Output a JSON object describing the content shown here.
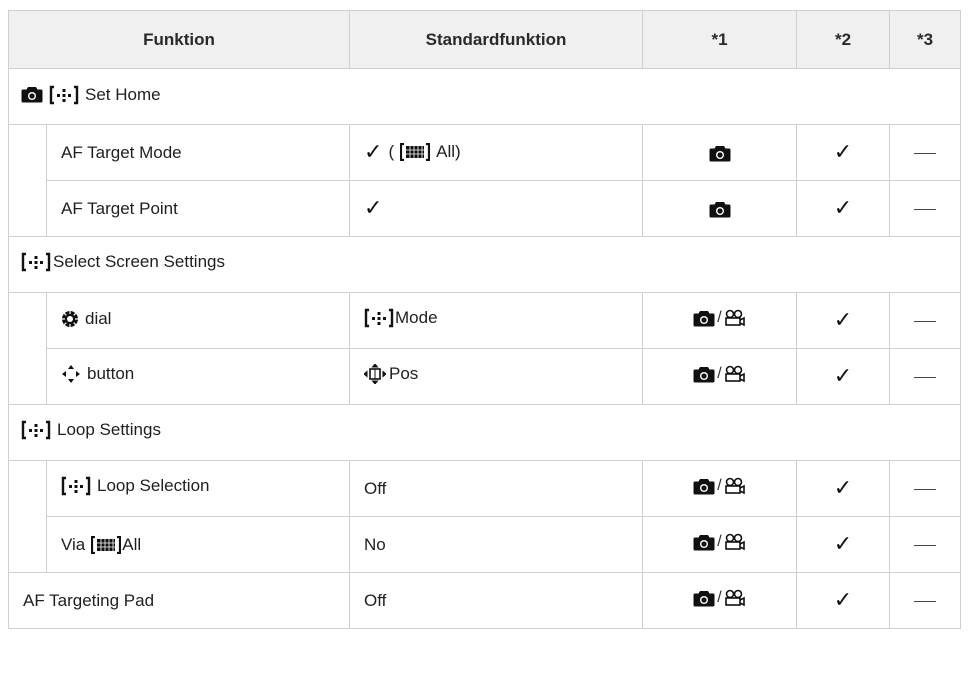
{
  "table": {
    "headers": [
      "Funktion",
      "Standardfunktion",
      "*1",
      "*2",
      "*3"
    ],
    "sections": [
      {
        "title": "Set Home",
        "title_icons": [
          "camera-icon",
          "af-area-icon"
        ],
        "rows": [
          {
            "name": "AF Target Mode",
            "std_prefix_icon": "check-icon",
            "std_paren_open": "(",
            "std_icon": "all-target-icon",
            "std_text": "All)",
            "col1": "camera-icon",
            "col2": "check-icon",
            "col3": "dash"
          },
          {
            "name": "AF Target Point",
            "std_prefix_icon": "check-icon",
            "col1": "camera-icon",
            "col2": "check-icon",
            "col3": "dash"
          }
        ]
      },
      {
        "title": "Select Screen Settings",
        "title_icons": [
          "af-area-icon"
        ],
        "rows": [
          {
            "name_icon": "dial-icon",
            "name": "dial",
            "std_icon": "af-area-icon",
            "std_text": "Mode",
            "col1": "camera-video-icon",
            "col2": "check-icon",
            "col3": "dash"
          },
          {
            "name_icon": "arrow-pad-icon",
            "name": "button",
            "std_icon": "arrow-pad-small-icon",
            "std_text": "Pos",
            "col1": "camera-video-icon",
            "col2": "check-icon",
            "col3": "dash"
          }
        ]
      },
      {
        "title": "Loop Settings",
        "title_icons": [
          "af-area-icon"
        ],
        "rows": [
          {
            "name_icon": "af-area-icon",
            "name": "Loop Selection",
            "std_text": "Off",
            "col1": "camera-video-icon",
            "col2": "check-icon",
            "col3": "dash"
          },
          {
            "name_prefix": "Via",
            "name_icon": "all-target-icon",
            "name": "All",
            "std_text": "No",
            "col1": "camera-video-icon",
            "col2": "check-icon",
            "col3": "dash"
          }
        ]
      }
    ],
    "footer_row": {
      "name": "AF Targeting Pad",
      "std_text": "Off",
      "col1": "camera-video-icon",
      "col2": "check-icon",
      "col3": "dash"
    }
  }
}
